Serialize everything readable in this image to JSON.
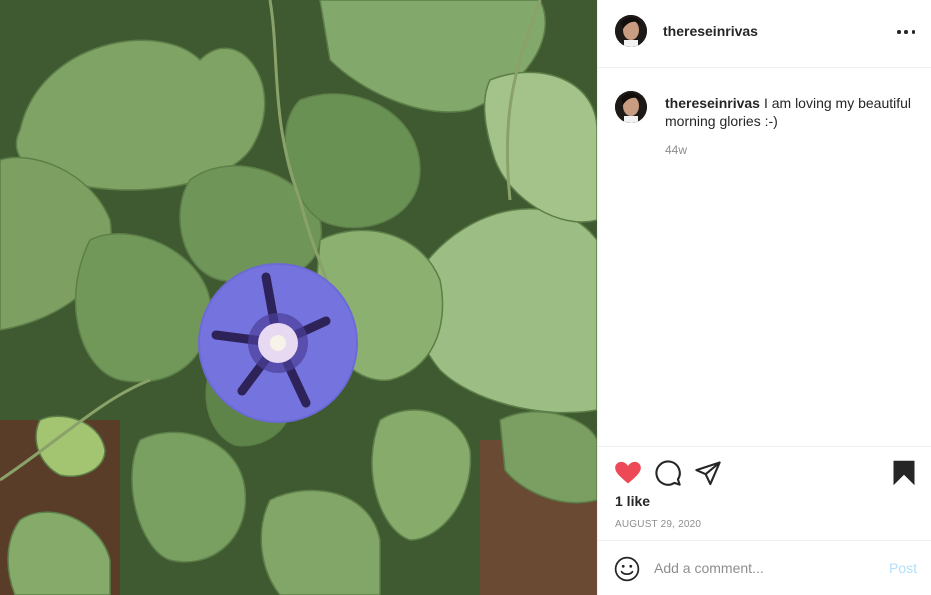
{
  "post": {
    "username": "thereseinrivas",
    "caption_username": "thereseinrivas",
    "caption_text": "I am loving my beautiful morning glories :-)",
    "age": "44w",
    "likes": "1 like",
    "date": "AUGUST 29, 2020"
  },
  "comment_box": {
    "placeholder": "Add a comment...",
    "post_label": "Post"
  },
  "icons": {
    "like": "heart-filled-icon",
    "comment": "speech-bubble-icon",
    "share": "paper-plane-icon",
    "save": "bookmark-filled-icon",
    "more": "more-options-icon",
    "emoji": "smiley-icon"
  },
  "colors": {
    "like_red": "#ed4956",
    "post_button_disabled": "#b2dffc",
    "secondary_text": "#8e8e8e",
    "divider": "#efefef"
  }
}
